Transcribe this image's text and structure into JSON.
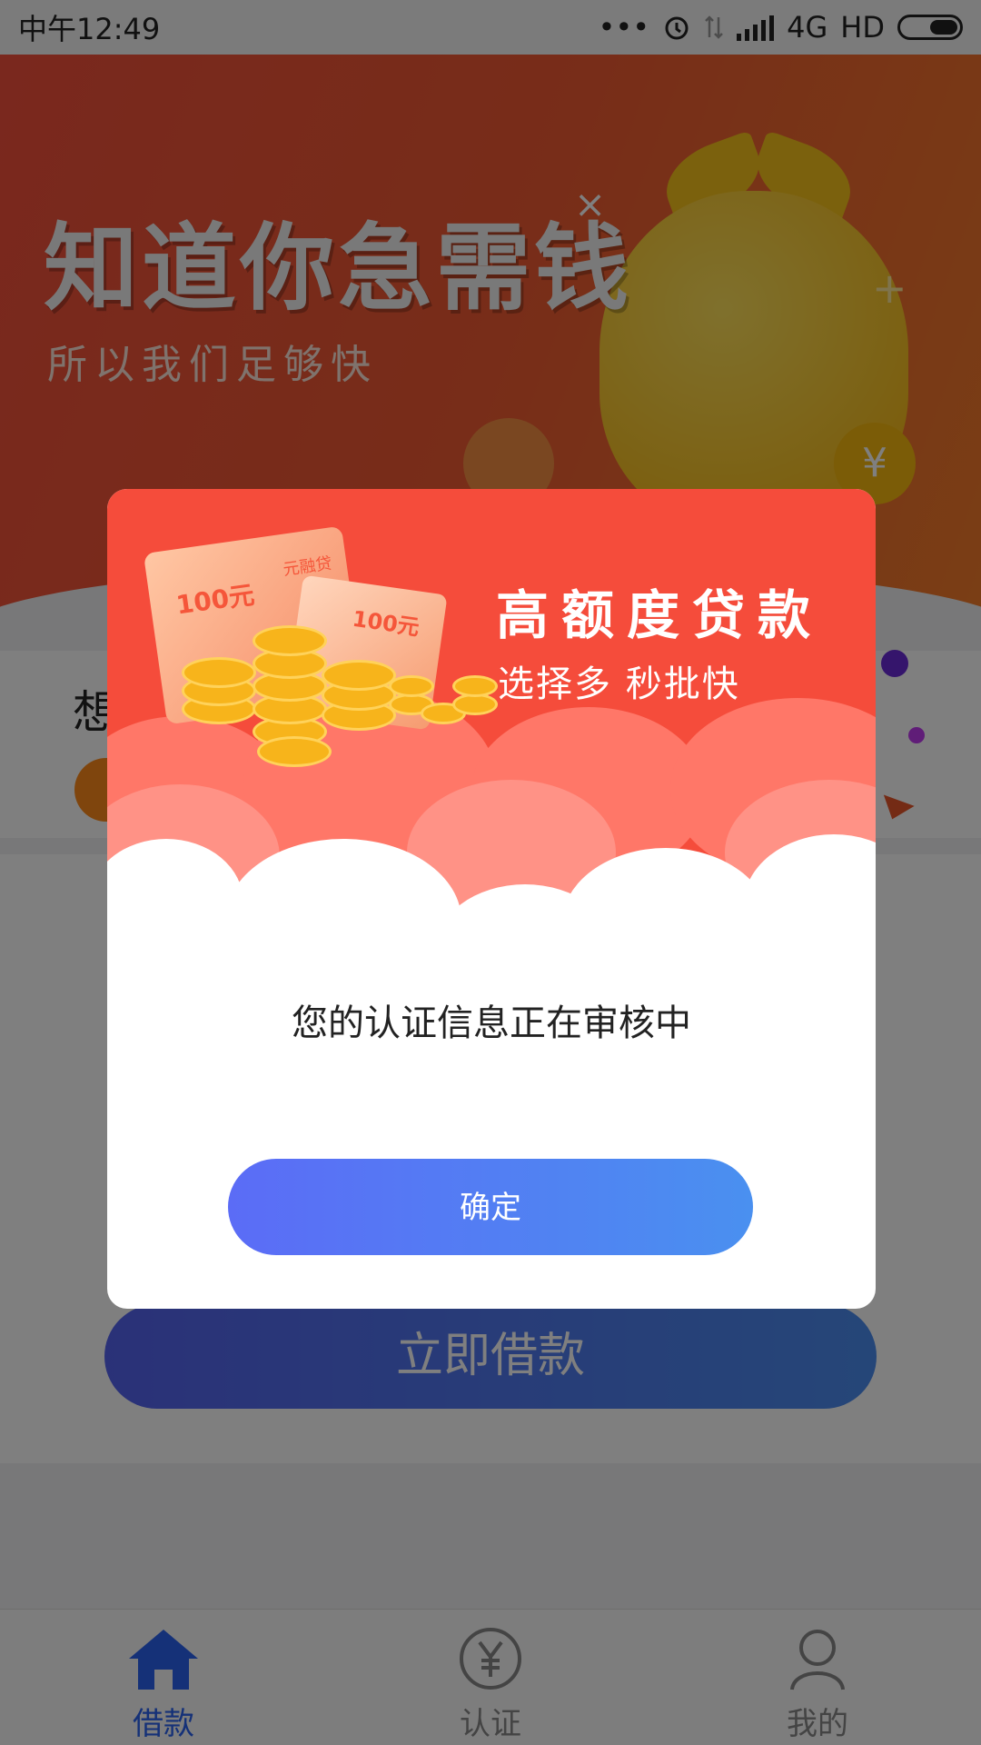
{
  "status_bar": {
    "time": "中午12:49",
    "dots": "•••",
    "network": "4G",
    "hd": "HD"
  },
  "banner": {
    "headline": "知道你急需钱",
    "subline": "所以我们足够快",
    "close_symbol": "×",
    "coin_symbol": "¥",
    "plus_symbol": "+"
  },
  "card": {
    "title_partial": "想"
  },
  "loan_button": {
    "label": "立即借款"
  },
  "dialog": {
    "title": "高额度贷款",
    "subtitle": "选择多  秒批快",
    "card_back_value": "100元",
    "card_back_brand": "元融贷",
    "card_front_value": "100元",
    "message": "您的认证信息正在审核中",
    "confirm_label": "确定"
  },
  "bottom_nav": {
    "items": [
      {
        "label": "借款",
        "icon": "home-icon",
        "active": true
      },
      {
        "label": "认证",
        "icon": "yen-circle-icon",
        "active": false
      },
      {
        "label": "我的",
        "icon": "user-icon",
        "active": false
      }
    ]
  },
  "colors": {
    "accent_blue": "#2b63f0",
    "dialog_red": "#f54c3b",
    "button_gradient_start": "#5b6cf6",
    "button_gradient_end": "#4a90f0"
  }
}
